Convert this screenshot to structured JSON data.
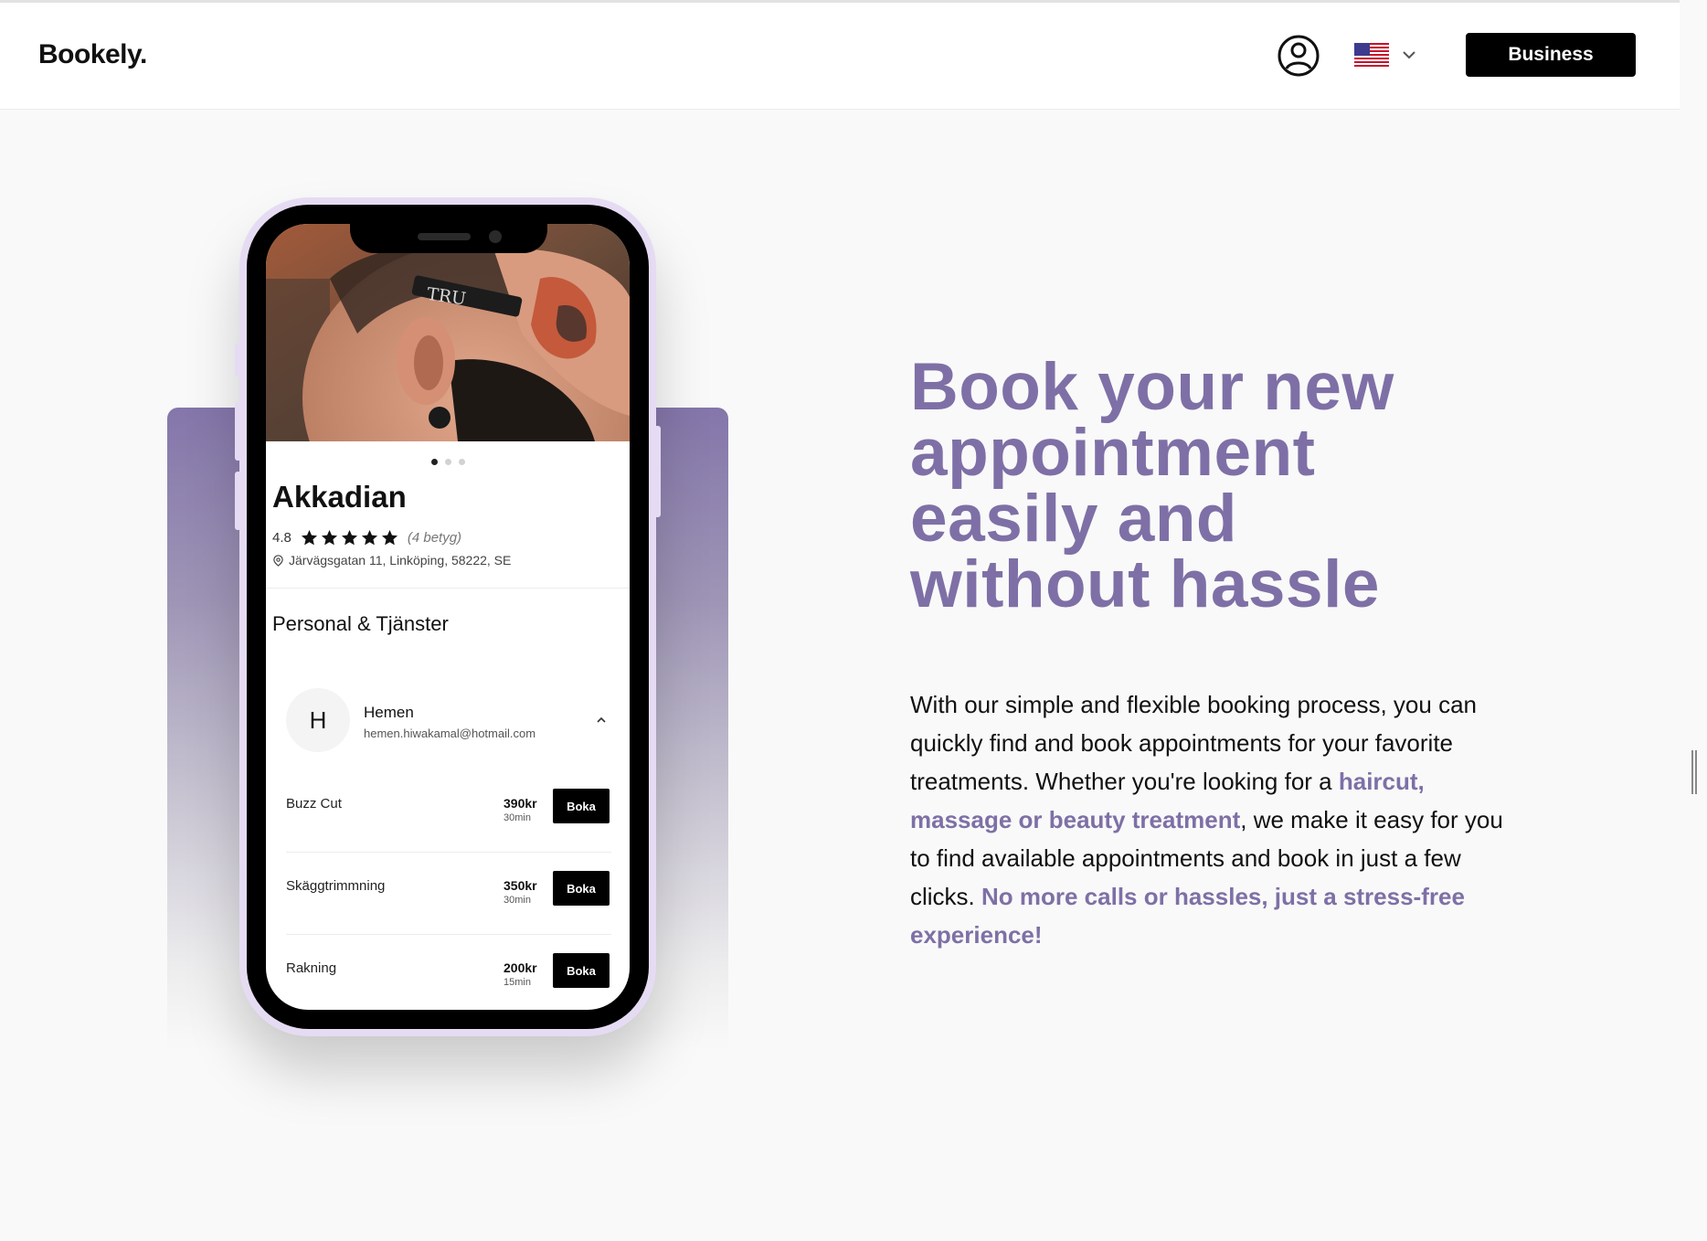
{
  "header": {
    "logo": "Bookely.",
    "account_icon": "user-circle-icon",
    "language_flag": "us-flag-icon",
    "business_label": "Business"
  },
  "phone_app": {
    "salon_name": "Akkadian",
    "rating": "4.8",
    "stars": 5,
    "rating_count": "(4 betyg)",
    "address": "Järvägsgatan 11, Linköping, 58222, SE",
    "section_title": "Personal & Tjänster",
    "staff": {
      "initial": "H",
      "name": "Hemen",
      "email": "hemen.hiwakamal@hotmail.com"
    },
    "services": [
      {
        "name": "Buzz Cut",
        "price": "390kr",
        "duration": "30min",
        "button": "Boka"
      },
      {
        "name": "Skäggtrimmning",
        "price": "350kr",
        "duration": "30min",
        "button": "Boka"
      },
      {
        "name": "Rakning",
        "price": "200kr",
        "duration": "15min",
        "button": "Boka"
      }
    ],
    "carousel": {
      "total": 3,
      "active": 0
    }
  },
  "hero": {
    "headline": "Book your new appointment easily and without hassle",
    "body_part1": "With our simple and flexible booking process, you can quickly find and book appointments for your favorite treatments. Whether you're looking for a ",
    "body_highlight1": "haircut, massage or beauty treatment",
    "body_part2": ", we make it easy for you to find available appointments and book in just a few clicks. ",
    "body_highlight2": "No more calls or hassles, just a stress-free experience!"
  },
  "colors": {
    "accent": "#7e70a6",
    "phone_frame": "#e5dcf3",
    "button": "#000000"
  }
}
